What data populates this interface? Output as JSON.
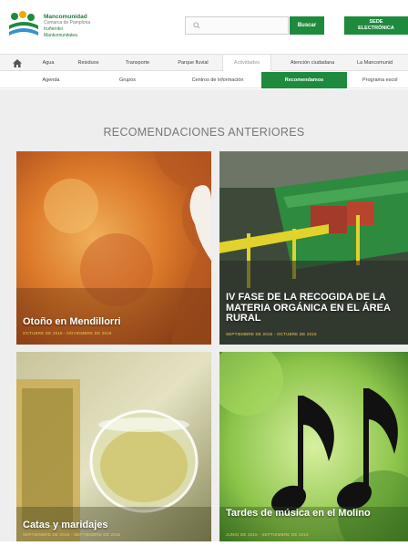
{
  "header": {
    "logo_lines": [
      "Mancomunidad",
      "Comarca de Pamplona",
      "Iruñerriko",
      "Mankomunitatea"
    ],
    "search": {
      "placeholder": "",
      "button_label": "Buscar"
    },
    "sede": {
      "line1": "SEDE",
      "line2": "ELECTRÓNICA"
    }
  },
  "nav_primary": [
    "Agua",
    "Residuos",
    "Transporte",
    "Parque fluvial",
    "Actividades",
    "Atención ciudadana",
    "La Mancomunid"
  ],
  "nav_primary_active": "Actividades",
  "nav_secondary": [
    "Agenda",
    "Grupos",
    "Centros de información",
    "Recomendamos",
    "Programa escol"
  ],
  "nav_secondary_active": "Recomendamos",
  "section_title": "RECOMENDACIONES ANTERIORES",
  "cards": [
    {
      "title": "Otoño en Mendillorri",
      "date": "OCTUBRE DE 2016 - NOVIEMBRE DE 2016"
    },
    {
      "title": "IV FASE DE LA RECOGIDA DE LA MATERIA ORGÁNICA EN EL ÁREA RURAL",
      "date": "SEPTIEMBRE DE 2016 - OCTUBRE DE 2016"
    },
    {
      "title": "Catas y maridajes",
      "date": "SEPTIEMBRE DE 2016 - SEPTIEMBRE DE 2016"
    },
    {
      "title": "Tardes de música en el Molino",
      "date": "JUNIO DE 2016 - SEPTIEMBRE DE 2016"
    }
  ],
  "colors": {
    "brand_green": "#1e8a3e",
    "date_yellow": "#f3c85a"
  }
}
